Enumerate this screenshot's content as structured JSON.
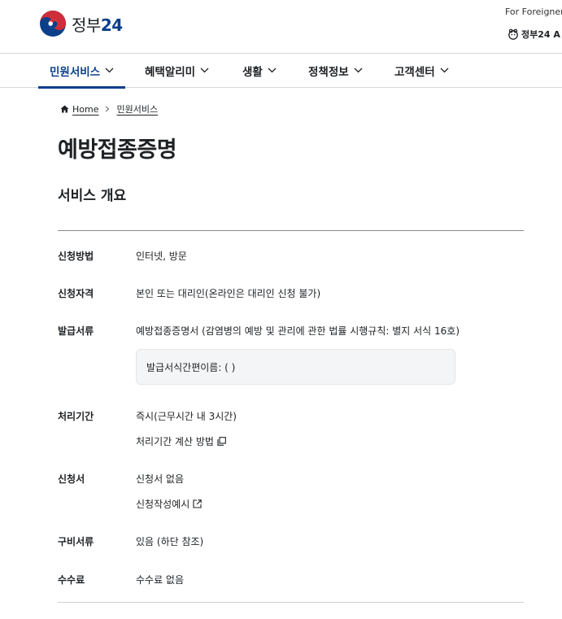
{
  "header": {
    "logo_text": "정부",
    "logo_num": "24",
    "for_foreigners": "For Foreigners",
    "gov_app": "정부24 A"
  },
  "gnb": {
    "items": [
      {
        "label": "민원서비스",
        "active": true
      },
      {
        "label": "혜택알리미",
        "active": false
      },
      {
        "label": "생활",
        "active": false
      },
      {
        "label": "정책정보",
        "active": false
      },
      {
        "label": "고객센터",
        "active": false
      }
    ]
  },
  "breadcrumb": {
    "home": "Home",
    "current": "민원서비스"
  },
  "page": {
    "title": "예방접종증명",
    "section_title": "서비스 개요"
  },
  "rows": {
    "method": {
      "label": "신청방법",
      "value": "인터넷, 방문"
    },
    "eligibility": {
      "label": "신청자격",
      "value": "본인 또는 대리인(온라인은 대리인 신청 불가)"
    },
    "document": {
      "label": "발급서류",
      "value": "예방접종증명서 (감염병의 예방 및 관리에 관한 법률 시행규칙: 별지 서식 16호)",
      "note": "발급서식간편이름: ( )"
    },
    "period": {
      "label": "처리기간",
      "value": "즉시(근무시간 내 3시간)",
      "link": "처리기간 계산 방법"
    },
    "application": {
      "label": "신청서",
      "value": "신청서 없음",
      "link": "신청작성예시"
    },
    "required_docs": {
      "label": "구비서류",
      "value": "있음 (하단 참조)"
    },
    "fee": {
      "label": "수수료",
      "value": "수수료 없음"
    }
  },
  "colors": {
    "brand_blue": "#0b3f8a",
    "brand_red": "#cd2e3a"
  }
}
